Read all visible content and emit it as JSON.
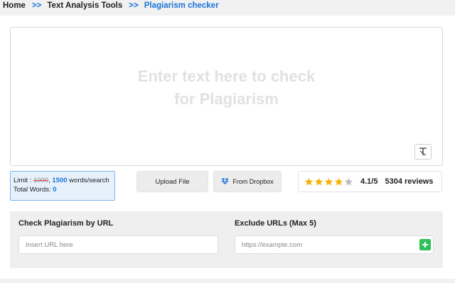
{
  "breadcrumb": {
    "items": [
      "Home",
      "Text Analysis Tools",
      "Plagiarism checker"
    ],
    "separator": ">>"
  },
  "editor": {
    "placeholder_line1": "Enter text here to check",
    "placeholder_line2": "for Plagiarism",
    "clear_icon": "clear-format-icon"
  },
  "limit": {
    "prefix": "Limit : ",
    "old_limit": "1000",
    "new_limit": "1500",
    "suffix": " words/search",
    "total_label": "Total Words: ",
    "total_value": "0"
  },
  "buttons": {
    "upload": "Upload File",
    "dropbox": "From Dropbox",
    "dropbox_icon": "dropbox-icon"
  },
  "rating": {
    "stars": 4,
    "max_stars": 5,
    "score": "4.1/5",
    "reviews": "5304 reviews",
    "star_color": "#f5b20b",
    "empty_star_color": "#bdbdbd"
  },
  "url_section": {
    "check_label": "Check Plagiarism by URL",
    "check_placeholder": "Insert URL here",
    "exclude_label": "Exclude URLs (Max 5)",
    "exclude_placeholder": "https://example.com",
    "add_icon": "plus-icon",
    "add_color": "#2ec15a"
  },
  "colors": {
    "accent": "#1a73d9"
  }
}
